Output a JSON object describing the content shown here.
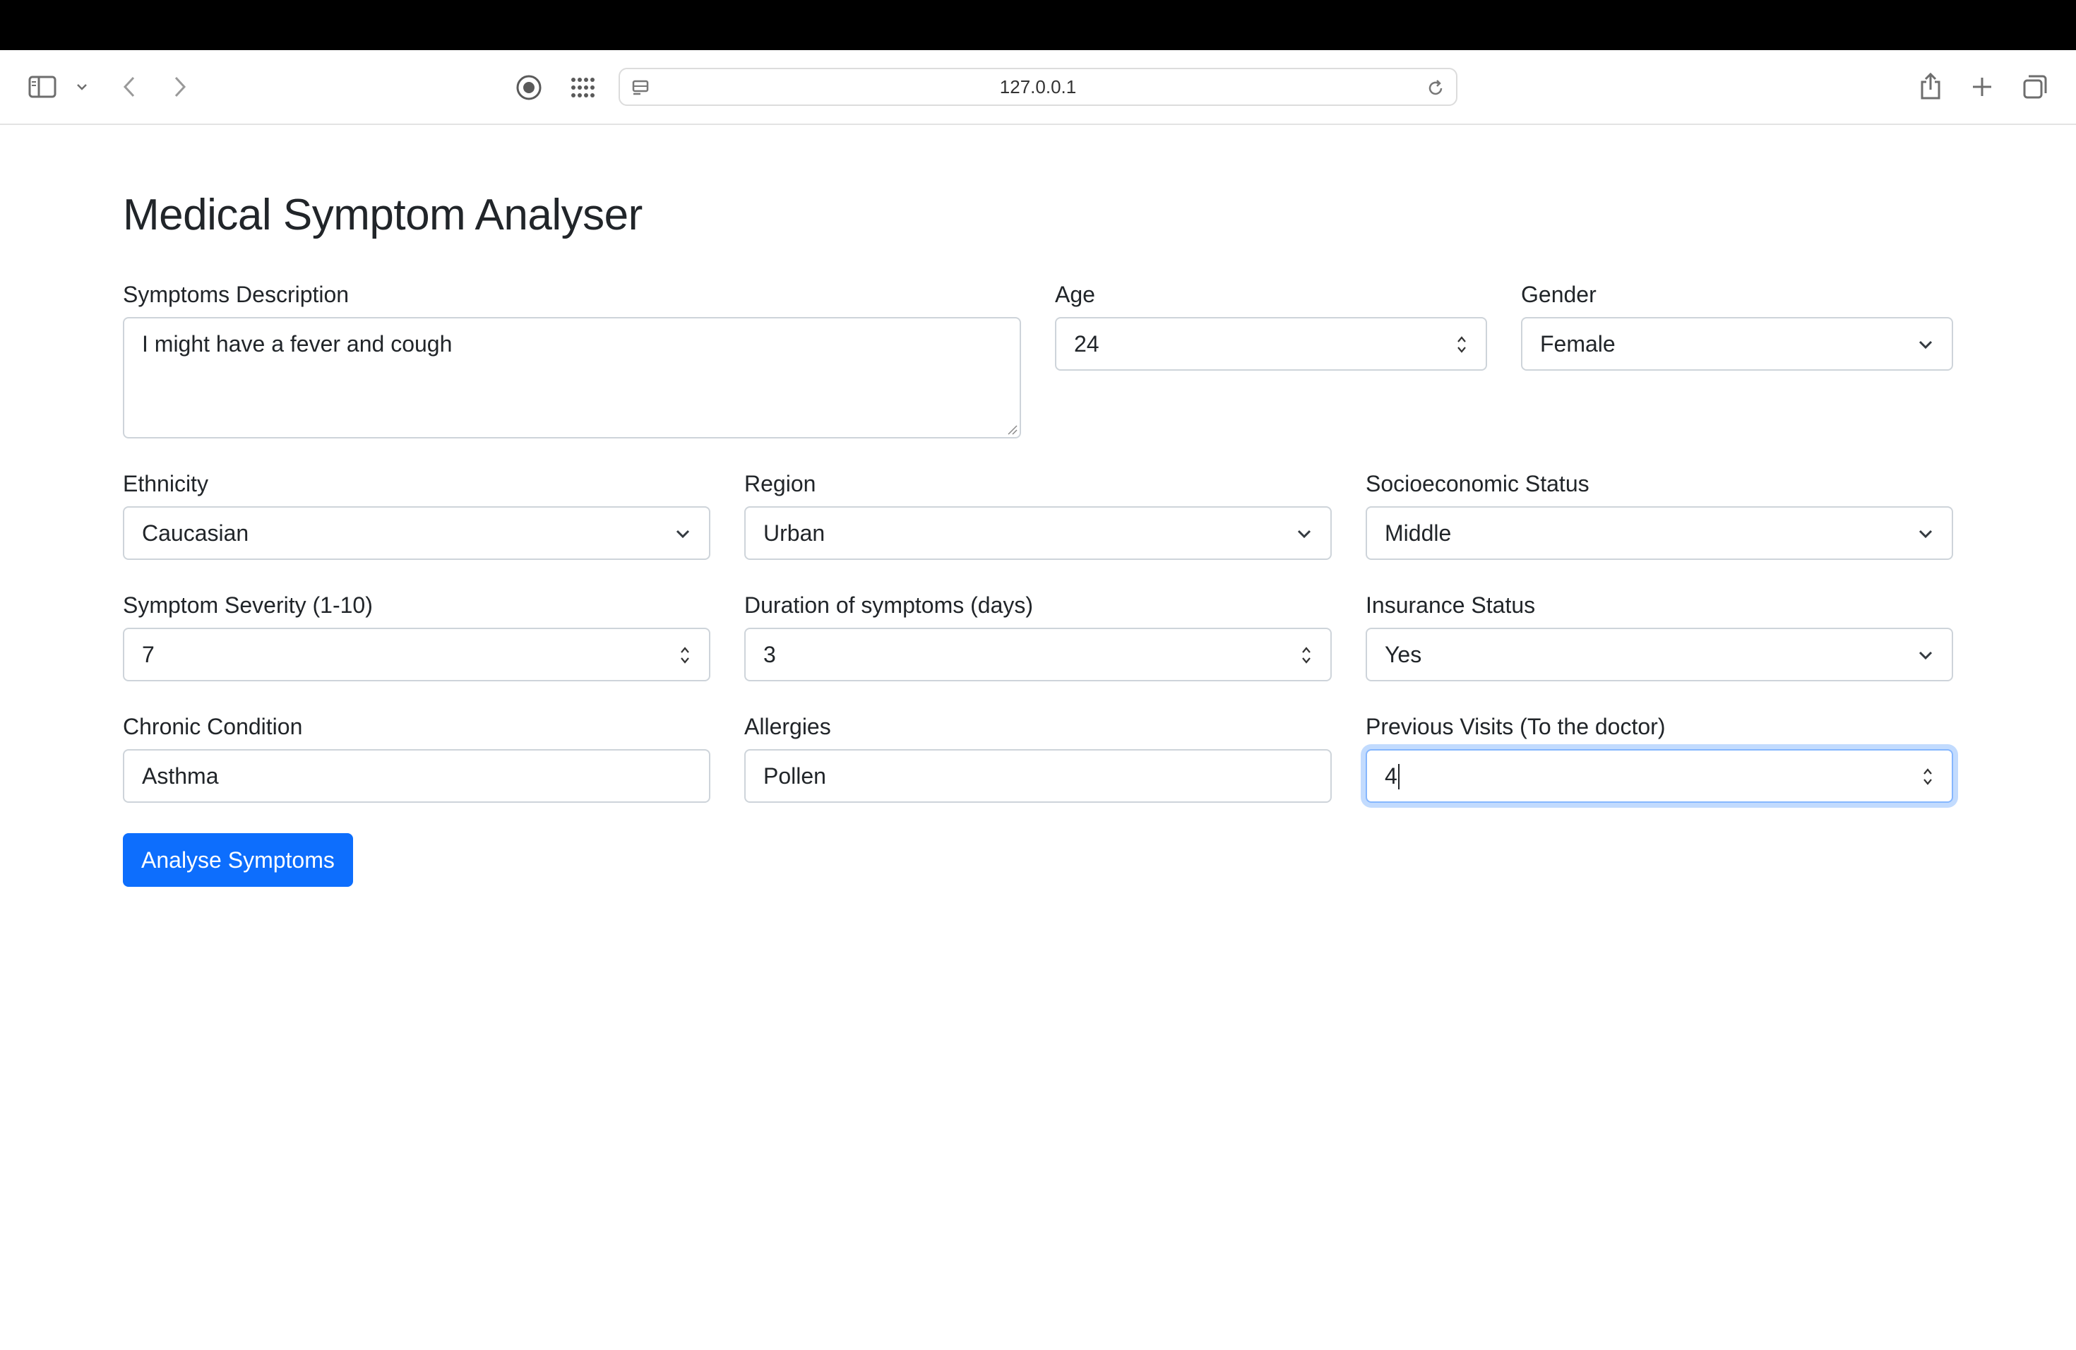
{
  "browser": {
    "url": "127.0.0.1"
  },
  "page": {
    "title": "Medical Symptom Analyser"
  },
  "form": {
    "symptoms": {
      "label": "Symptoms Description",
      "value": "I might have a fever and cough"
    },
    "age": {
      "label": "Age",
      "value": "24"
    },
    "gender": {
      "label": "Gender",
      "value": "Female"
    },
    "ethnicity": {
      "label": "Ethnicity",
      "value": "Caucasian"
    },
    "region": {
      "label": "Region",
      "value": "Urban"
    },
    "socioeconomic": {
      "label": "Socioeconomic Status",
      "value": "Middle"
    },
    "severity": {
      "label": "Symptom Severity (1-10)",
      "value": "7"
    },
    "duration": {
      "label": "Duration of symptoms (days)",
      "value": "3"
    },
    "insurance": {
      "label": "Insurance Status",
      "value": "Yes"
    },
    "chronic": {
      "label": "Chronic Condition",
      "value": "Asthma"
    },
    "allergies": {
      "label": "Allergies",
      "value": "Pollen"
    },
    "visits": {
      "label": "Previous Visits (To the doctor)",
      "value": "4"
    },
    "submit_label": "Analyse Symptoms"
  },
  "colors": {
    "primary": "#0d6efd",
    "text": "#212529",
    "border": "#ced4da",
    "focus": "#86b7fe"
  }
}
